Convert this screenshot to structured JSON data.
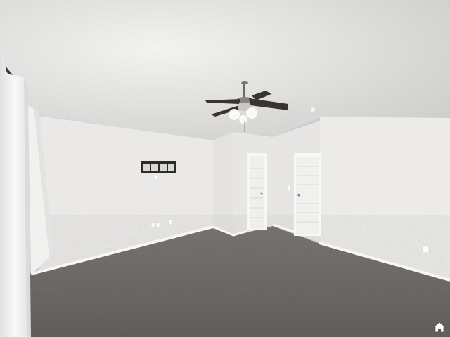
{
  "scene": {
    "subject": "empty-room",
    "colors": {
      "ceiling": "#d9d8d6",
      "ceiling_light": "#eeeeec",
      "wall_left": "#eceae8",
      "wall_center": "#e6e5e3",
      "wall_right": "#ececea",
      "wall_shadow": "#dcdbd8",
      "carpet": "#6f6a68",
      "carpet_light": "#8a8583",
      "trim": "#f7f7f5",
      "door": "#f1f1ef",
      "fan_blade": "#3a3431",
      "curtain": "#f4f5f3"
    },
    "icons": {
      "watermark": "house-icon",
      "fan": "ceiling-fan-icon"
    }
  }
}
